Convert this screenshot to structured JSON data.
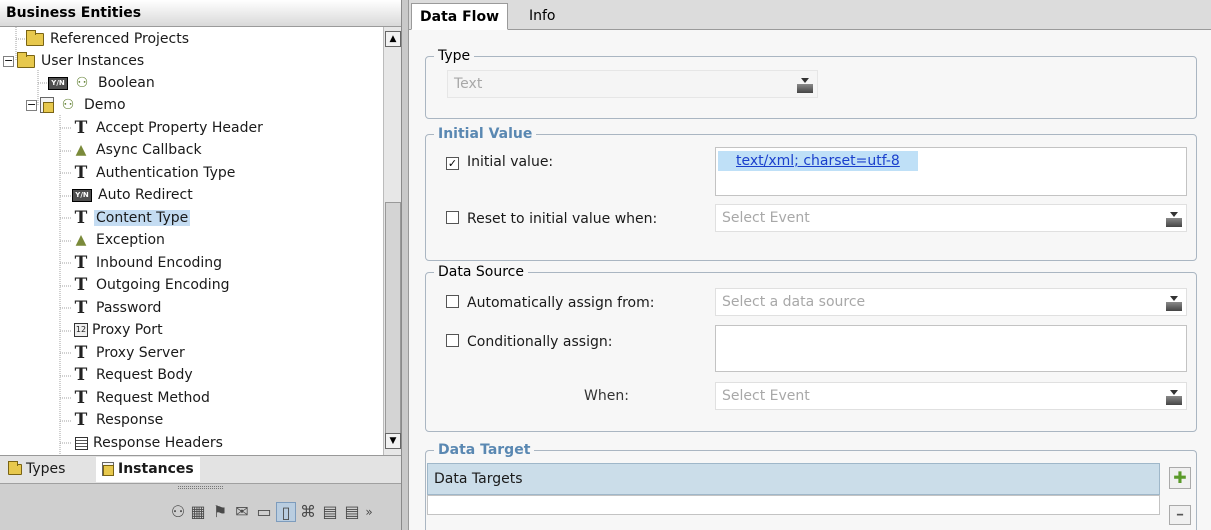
{
  "left_panel": {
    "title": "Business Entities",
    "tree": [
      {
        "label": "Referenced Projects",
        "icon": "folder-icon"
      },
      {
        "label": "User Instances",
        "icon": "folder-open-icon",
        "expander": "−"
      },
      {
        "label": "Boolean",
        "icon": "yes-no-icon"
      },
      {
        "label": "Demo",
        "icon": "document-folder-icon",
        "expander": "−"
      },
      {
        "label": "Accept Property Header",
        "icon": "text-type-icon"
      },
      {
        "label": "Async Callback",
        "icon": "bell-icon"
      },
      {
        "label": "Authentication Type",
        "icon": "text-type-icon"
      },
      {
        "label": "Auto Redirect",
        "icon": "yes-no-icon"
      },
      {
        "label": "Content Type",
        "icon": "text-type-icon",
        "selected": true
      },
      {
        "label": "Exception",
        "icon": "bell-icon"
      },
      {
        "label": "Inbound Encoding",
        "icon": "text-type-icon"
      },
      {
        "label": "Outgoing Encoding",
        "icon": "text-type-icon"
      },
      {
        "label": "Password",
        "icon": "text-type-icon"
      },
      {
        "label": "Proxy Port",
        "icon": "number-icon"
      },
      {
        "label": "Proxy Server",
        "icon": "text-type-icon"
      },
      {
        "label": "Request Body",
        "icon": "text-type-icon"
      },
      {
        "label": "Request Method",
        "icon": "text-type-icon"
      },
      {
        "label": "Response",
        "icon": "text-type-icon"
      },
      {
        "label": "Response Headers",
        "icon": "list-icon"
      }
    ],
    "icon_text": {
      "yes_no": "Y/N",
      "number": "12"
    },
    "bottom_tabs": [
      {
        "label": "Types",
        "active": false
      },
      {
        "label": "Instances",
        "active": true
      }
    ]
  },
  "right_panel": {
    "tabs": [
      {
        "label": "Data Flow",
        "active": true
      },
      {
        "label": "Info",
        "active": false
      }
    ],
    "type_group": {
      "legend": "Type",
      "combo_value": "Text"
    },
    "initial_value_group": {
      "legend": "Initial Value",
      "initial_value_label": "Initial value:",
      "initial_value_checked": true,
      "initial_value_text": "text/xml; charset=utf-8",
      "reset_label": "Reset to initial value when:",
      "reset_checked": false,
      "reset_placeholder": "Select Event"
    },
    "data_source_group": {
      "legend": "Data Source",
      "auto_label": "Automatically assign from:",
      "auto_placeholder": "Select a data source",
      "cond_label": "Conditionally assign:",
      "when_label": "When:",
      "when_placeholder": "Select Event"
    },
    "data_target_group": {
      "legend": "Data Target",
      "table_header": "Data Targets"
    }
  }
}
